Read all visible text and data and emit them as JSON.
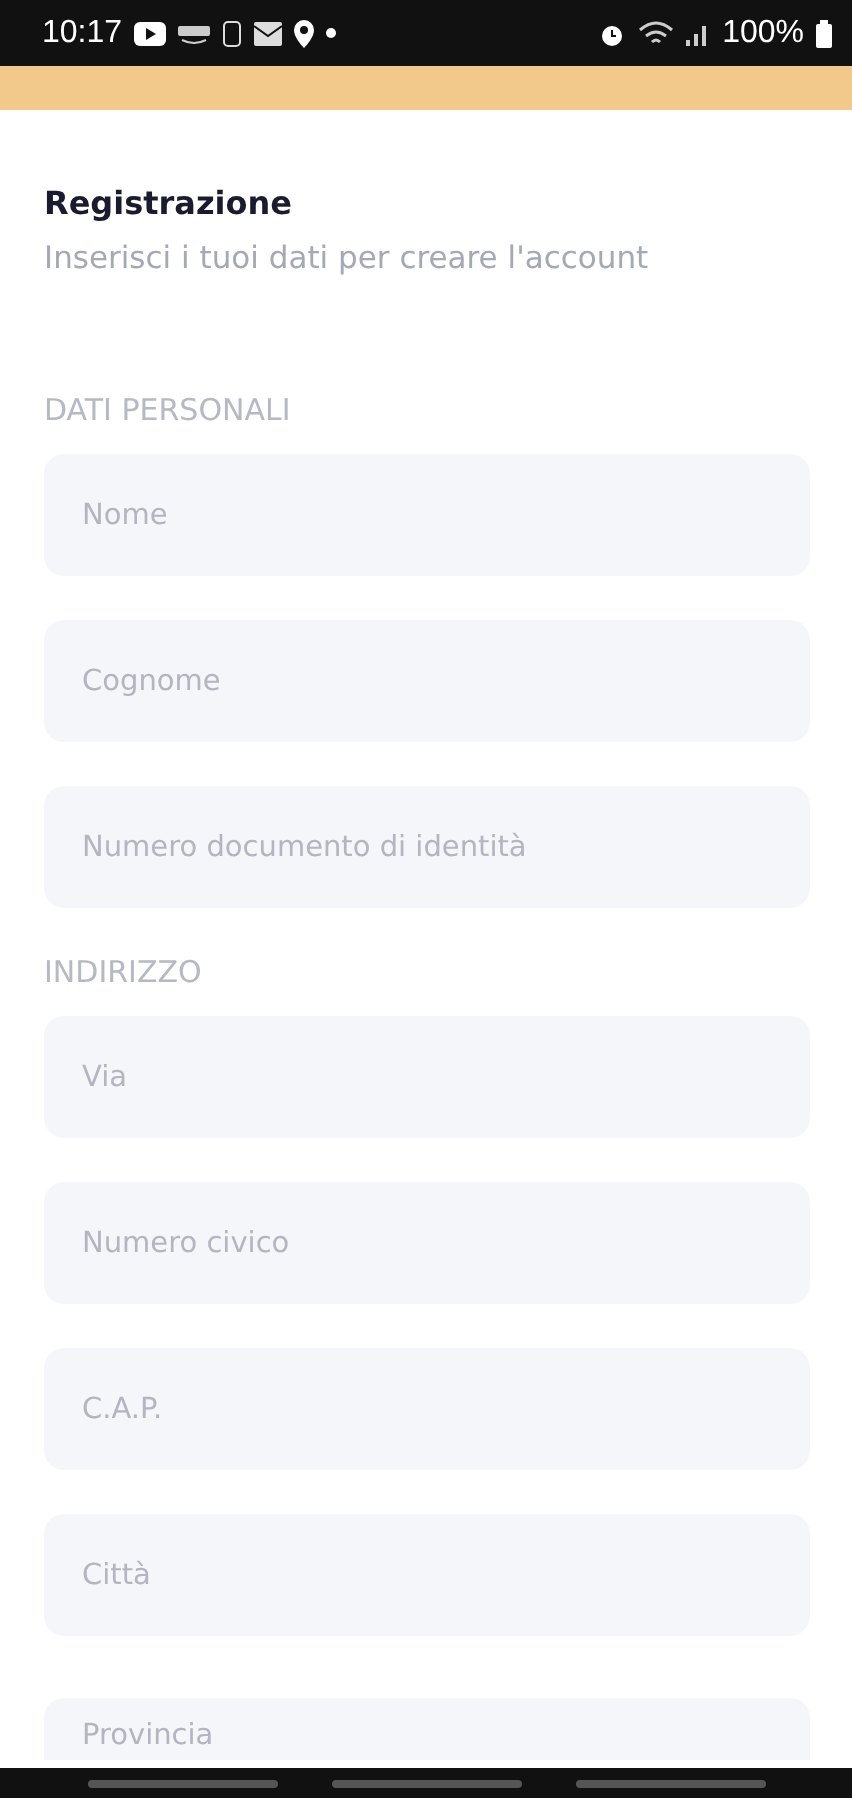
{
  "status_bar": {
    "time": "10:17",
    "battery": "100%"
  },
  "header": {
    "title": "Registrazione",
    "subtitle": "Inserisci i tuoi dati per creare l'account"
  },
  "sections": [
    {
      "heading": "DATI PERSONALI",
      "fields": [
        {
          "placeholder": "Nome"
        },
        {
          "placeholder": "Cognome"
        },
        {
          "placeholder": "Numero documento di identità"
        }
      ]
    },
    {
      "heading": "INDIRIZZO",
      "fields": [
        {
          "placeholder": "Via"
        },
        {
          "placeholder": "Numero civico"
        },
        {
          "placeholder": "C.A.P."
        },
        {
          "placeholder": "Città"
        },
        {
          "placeholder": "Provincia"
        }
      ]
    }
  ]
}
